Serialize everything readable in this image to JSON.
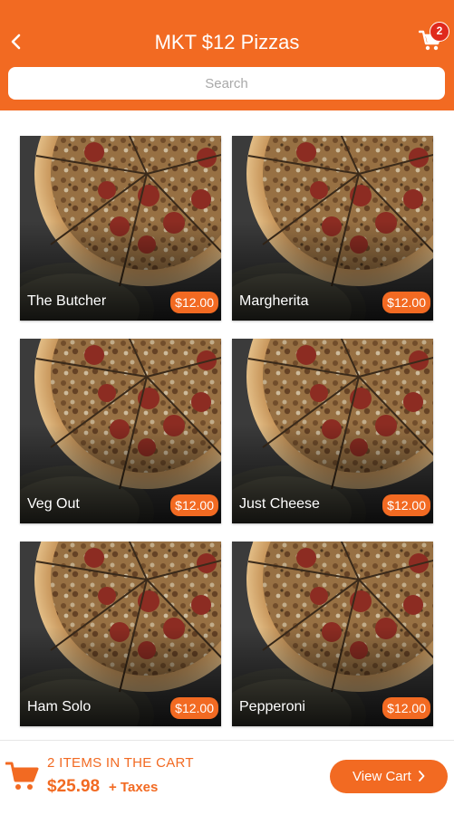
{
  "header": {
    "title": "MKT $12 Pizzas",
    "back_icon": "chevron-left-icon",
    "cart_icon": "shopping-cart-icon",
    "cart_count": "2"
  },
  "search": {
    "placeholder": "Search",
    "value": ""
  },
  "products": [
    {
      "name": "The Butcher",
      "price": "$12.00"
    },
    {
      "name": "Margherita",
      "price": "$12.00"
    },
    {
      "name": "Veg Out",
      "price": "$12.00"
    },
    {
      "name": "Just Cheese",
      "price": "$12.00"
    },
    {
      "name": "Ham Solo",
      "price": "$12.00"
    },
    {
      "name": "Pepperoni",
      "price": "$12.00"
    }
  ],
  "footer": {
    "cart_icon": "shopping-cart-icon",
    "items_text": "2 ITEMS IN THE CART",
    "total": "$25.98",
    "taxes": "+ Taxes",
    "view_cart_label": "View Cart",
    "view_cart_icon": "chevron-right-icon"
  },
  "colors": {
    "accent": "#f26a22",
    "badge": "#e02a1e"
  }
}
